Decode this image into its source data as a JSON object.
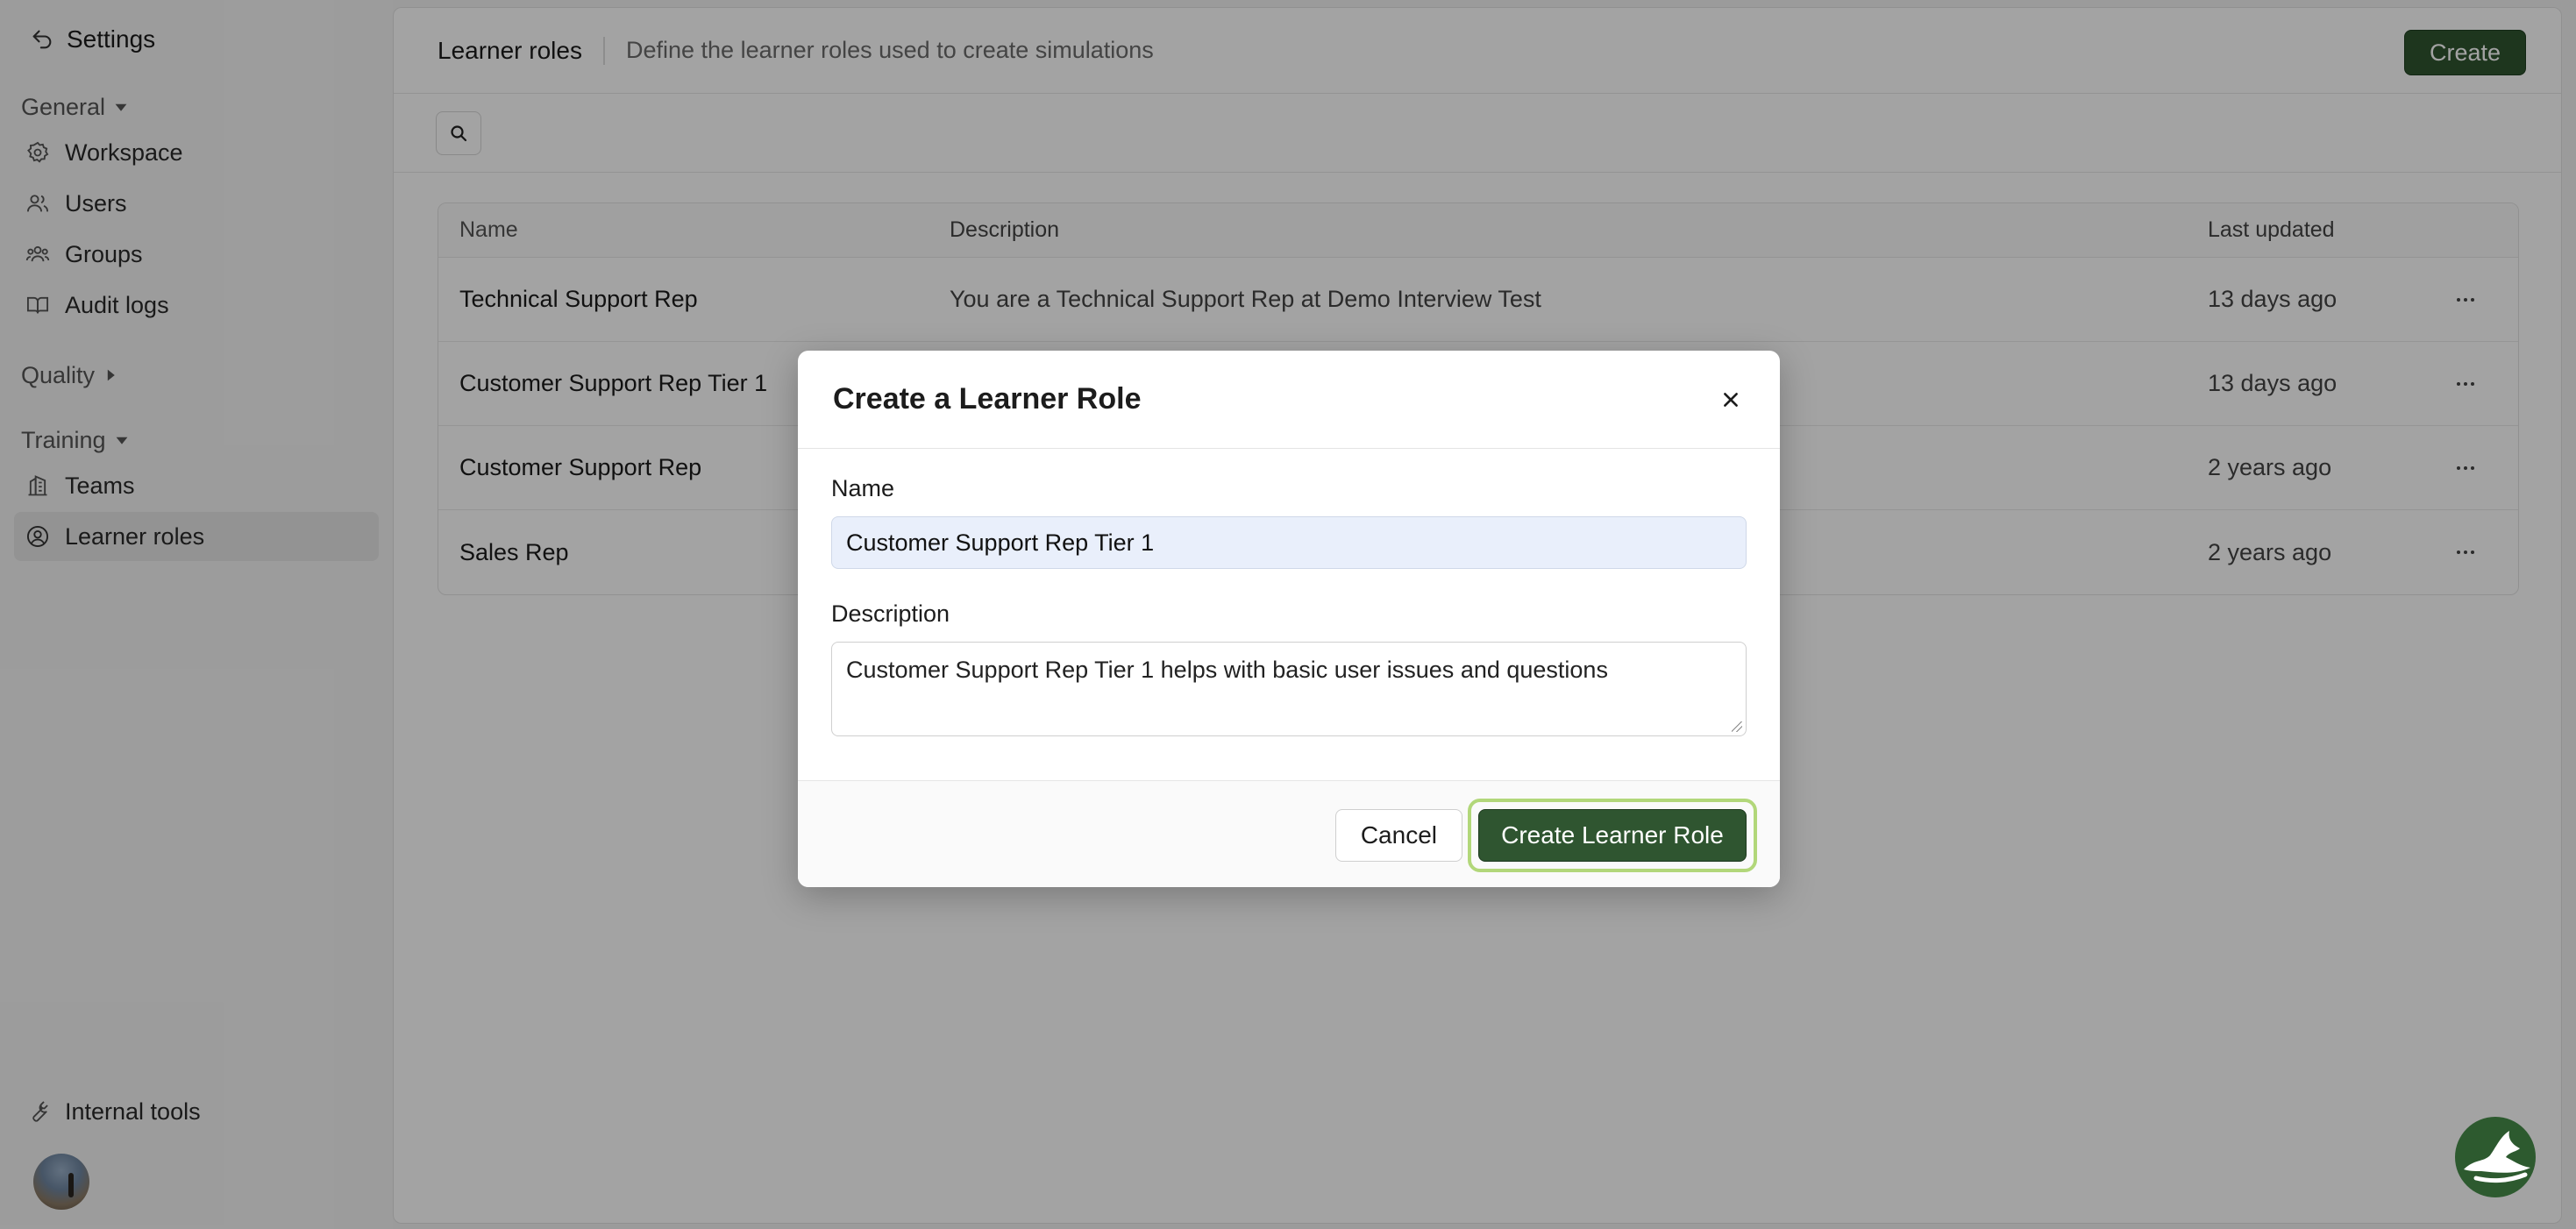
{
  "sidebar": {
    "title": "Settings",
    "sections": [
      {
        "label": "General",
        "expanded": true,
        "items": [
          {
            "label": "Workspace",
            "icon": "gear-icon"
          },
          {
            "label": "Users",
            "icon": "users-icon"
          },
          {
            "label": "Groups",
            "icon": "groups-icon"
          },
          {
            "label": "Audit logs",
            "icon": "book-icon"
          }
        ]
      },
      {
        "label": "Quality",
        "expanded": false,
        "items": []
      },
      {
        "label": "Training",
        "expanded": true,
        "items": [
          {
            "label": "Teams",
            "icon": "building-icon"
          },
          {
            "label": "Learner roles",
            "icon": "user-circle-icon",
            "active": true
          }
        ]
      }
    ],
    "internal_tools": "Internal tools"
  },
  "header": {
    "title": "Learner roles",
    "description": "Define the learner roles used to create simulations",
    "create_label": "Create"
  },
  "table": {
    "columns": [
      "Name",
      "Description",
      "Last updated"
    ],
    "rows": [
      {
        "name": "Technical Support Rep",
        "description": "You are a Technical Support Rep at Demo Interview Test",
        "updated": "13 days ago"
      },
      {
        "name": "Customer Support Rep Tier 1",
        "description": "",
        "updated": "13 days ago"
      },
      {
        "name": "Customer Support Rep",
        "description": "",
        "updated": "2 years ago"
      },
      {
        "name": "Sales Rep",
        "description": "",
        "updated": "2 years ago"
      }
    ]
  },
  "modal": {
    "title": "Create a Learner Role",
    "name_label": "Name",
    "name_value": "Customer Support Rep Tier 1",
    "description_label": "Description",
    "description_value": "Customer Support Rep Tier 1 helps with basic user issues and questions",
    "cancel_label": "Cancel",
    "submit_label": "Create Learner Role"
  },
  "colors": {
    "accent": "#2f5530",
    "focus_ring": "#b2d77a",
    "input_fill": "#e9effb"
  }
}
